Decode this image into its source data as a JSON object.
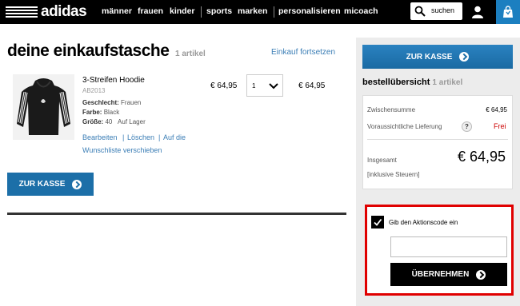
{
  "header": {
    "logo_text": "adidas",
    "nav": [
      "männer",
      "frauen",
      "kinder",
      "sports",
      "marken",
      "personalisieren",
      "micoach"
    ],
    "search_label": "suchen"
  },
  "cart": {
    "title": "deine einkaufstasche",
    "count": "1 artikel",
    "continue_link": "Einkauf fortsetzen",
    "item": {
      "name": "3-Streifen Hoodie",
      "sku": "AB2013",
      "gender_label": "Geschlecht:",
      "gender": "Frauen",
      "color_label": "Farbe:",
      "color": "Black",
      "size_label": "Größe:",
      "size": "40",
      "availability": "Auf Lager",
      "edit": "Bearbeiten",
      "delete": "Löschen",
      "wishlist_line1": "Auf die",
      "wishlist_line2": "Wunschliste verschieben",
      "price": "€ 64,95",
      "qty": "1",
      "total": "€ 64,95"
    },
    "checkout_button": "ZUR KASSE"
  },
  "summary": {
    "checkout_button": "ZUR KASSE",
    "title": "bestellübersicht",
    "count": "1 artikel",
    "subtotal_label": "Zwischensumme",
    "subtotal_value": "€ 64,95",
    "shipping_label": "Voraussichtliche Lieferung",
    "shipping_help": "?",
    "shipping_value": "Frei",
    "total_label": "Insgesamt",
    "total_value": "€ 64,95",
    "tax_note": "[inklusive Steuern]"
  },
  "promo": {
    "label": "Gib den Aktionscode ein",
    "input_value": "",
    "apply_button": "ÜBERNEHMEN"
  },
  "colors": {
    "accent_blue": "#1c6fa8",
    "promo_border": "#e00000",
    "free_red": "#cc0000"
  }
}
